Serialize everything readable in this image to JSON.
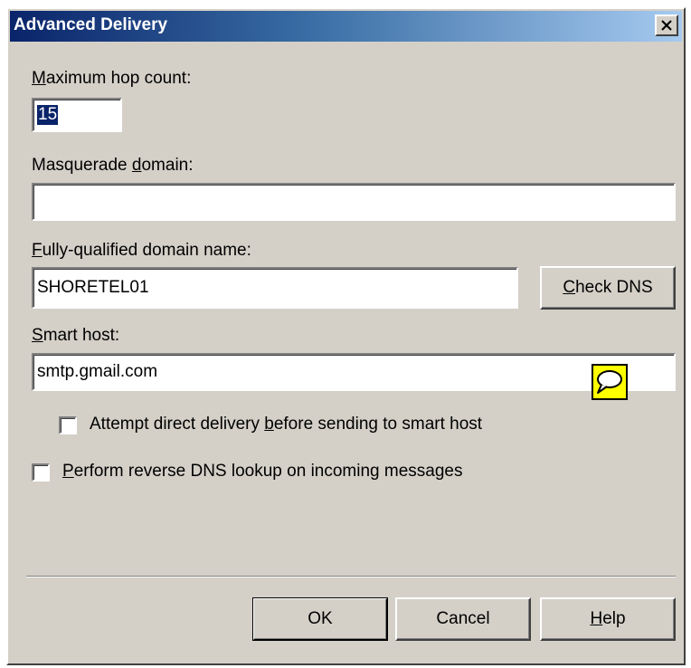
{
  "window": {
    "title": "Advanced Delivery"
  },
  "hop_count": {
    "label_pre": "",
    "label_key": "M",
    "label_post": "aximum hop count:",
    "value": "15"
  },
  "masquerade": {
    "label_pre": "Masquerade ",
    "label_key": "d",
    "label_post": "omain:",
    "value": ""
  },
  "fqdn": {
    "label_pre": "",
    "label_key": "F",
    "label_post": "ully-qualified domain name:",
    "value": "SHORETEL01",
    "check_dns_key": "C",
    "check_dns_rest": "heck DNS"
  },
  "smart_host": {
    "label_pre": "",
    "label_key": "S",
    "label_post": "mart host:",
    "value": "smtp.gmail.com"
  },
  "direct_delivery": {
    "label_pre": "Attempt direct delivery ",
    "label_key": "b",
    "label_post": "efore sending to smart host",
    "checked": false
  },
  "reverse_dns": {
    "label_pre": "",
    "label_key": "P",
    "label_post": "erform reverse DNS lookup on incoming messages",
    "checked": false
  },
  "buttons": {
    "ok": "OK",
    "cancel": "Cancel",
    "help_key": "H",
    "help_rest": "elp"
  }
}
